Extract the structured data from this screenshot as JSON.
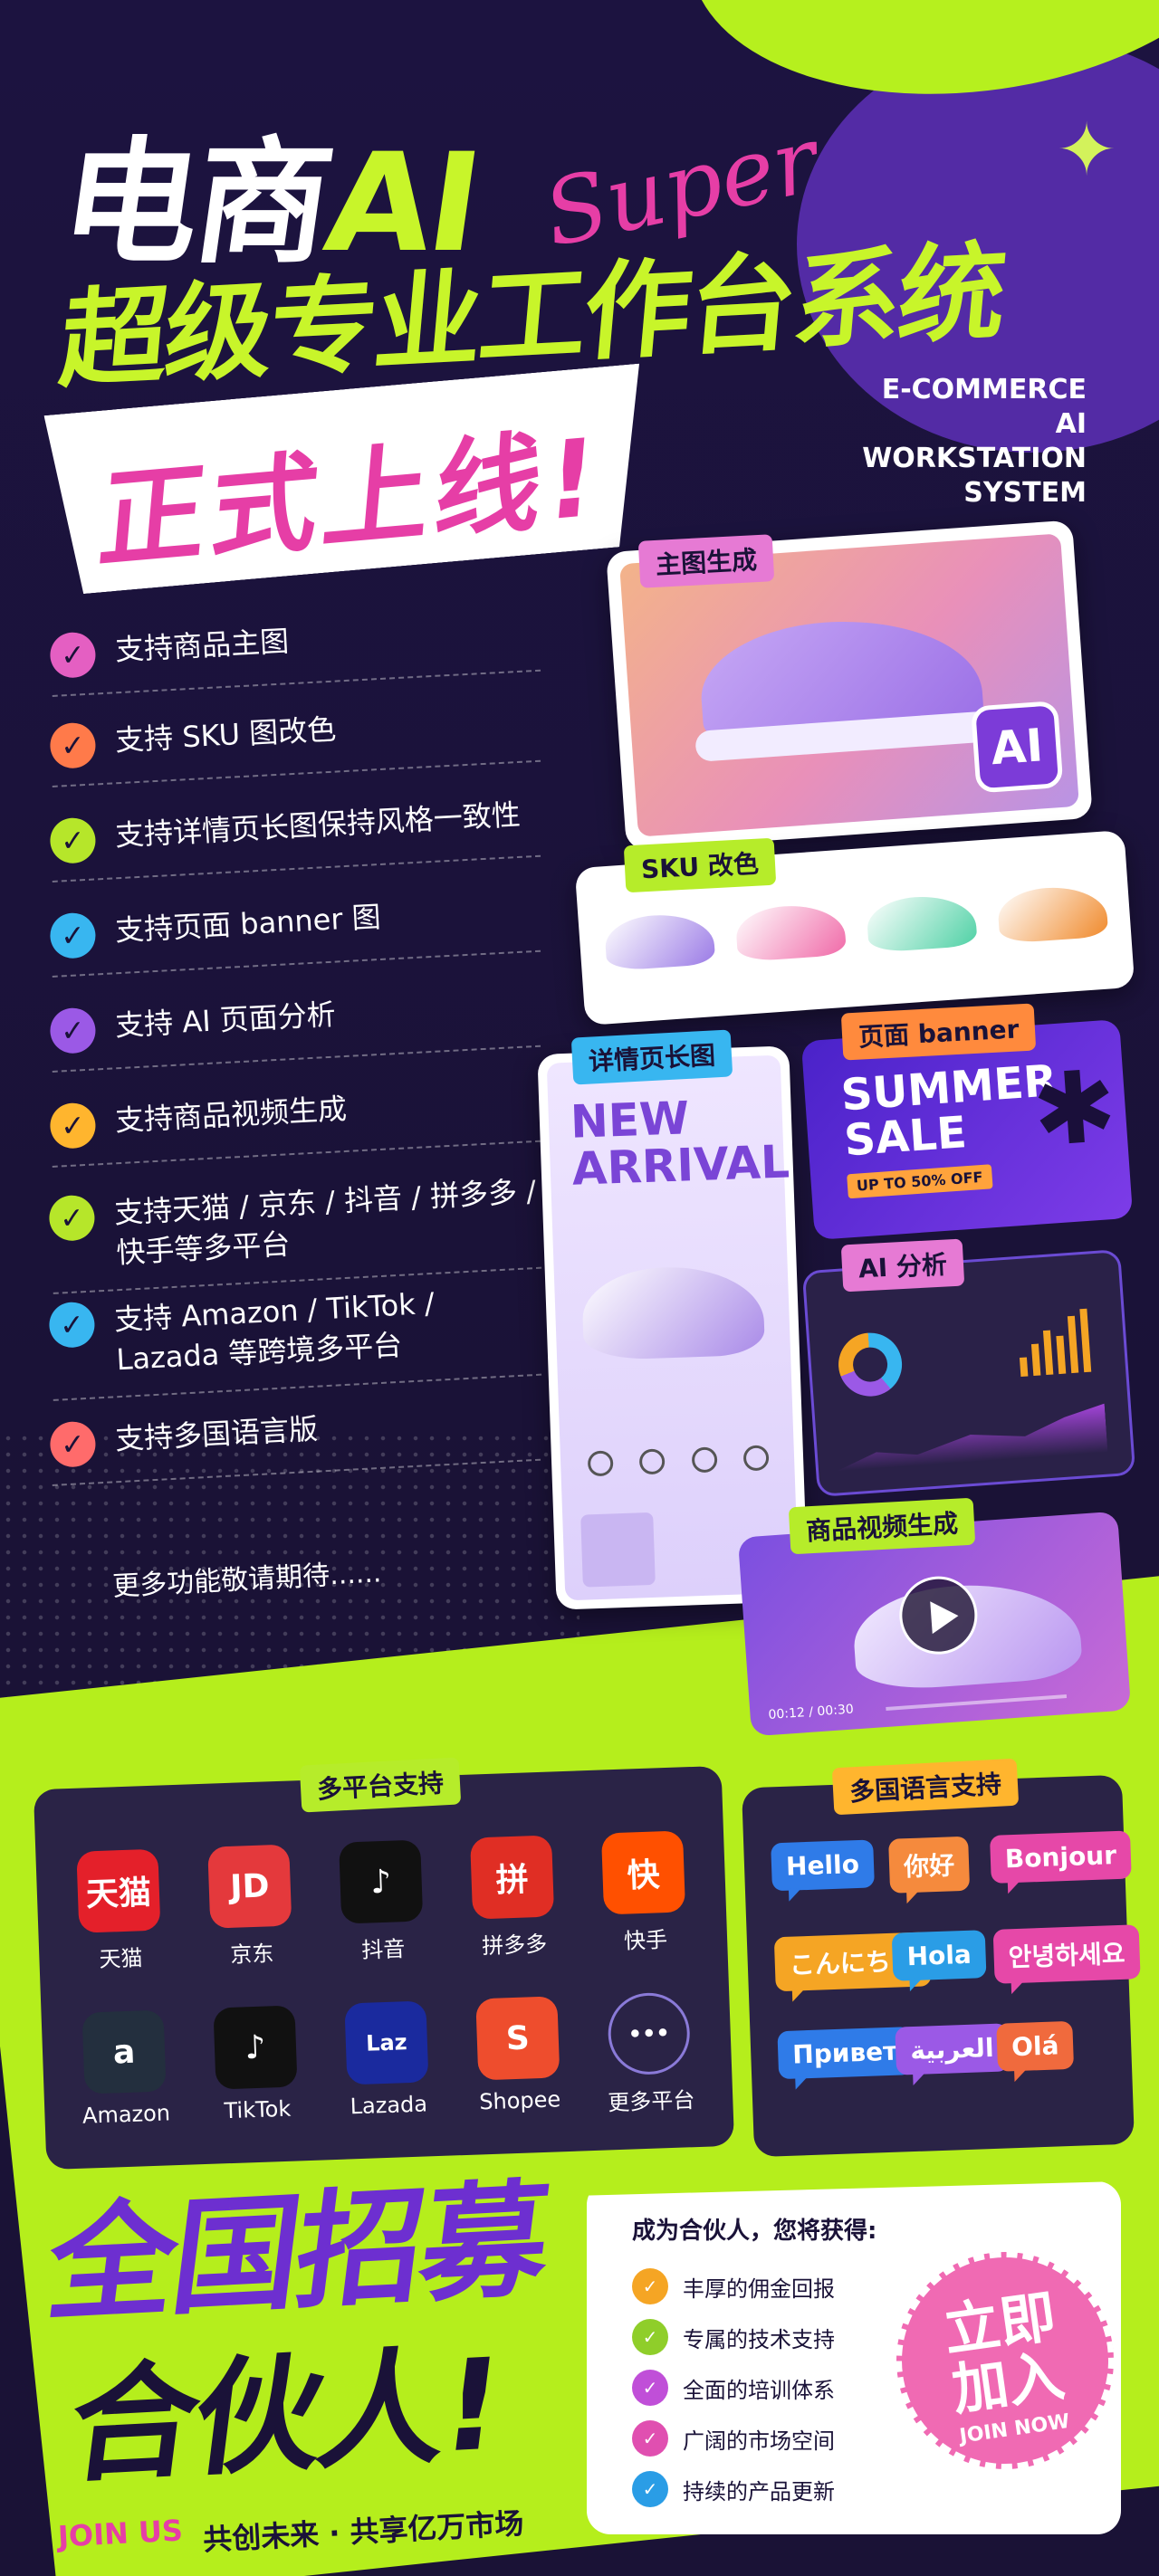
{
  "title": {
    "line1_part1": "电商",
    "line1_part2": "AI",
    "script": "Super",
    "line2": "超级专业工作台系统",
    "english": [
      "E-COMMERCE",
      "AI WORKSTATION",
      "SYSTEM"
    ],
    "launch": "正式上线!"
  },
  "features": [
    {
      "text": "支持商品主图",
      "color": "#e45fc2"
    },
    {
      "text": "支持 SKU 图改色",
      "color": "#ff7a4a"
    },
    {
      "text": "支持详情页长图保持风格一致性",
      "color": "#b6e62a"
    },
    {
      "text": "支持页面 banner 图",
      "color": "#38b6f0"
    },
    {
      "text": "支持 AI 页面分析",
      "color": "#9b59e6"
    },
    {
      "text": "支持商品视频生成",
      "color": "#ffb52e"
    },
    {
      "text": "支持天猫 / 京东 / 抖音 / 拼多多 / 快手等多平台",
      "color": "#b6e62a"
    },
    {
      "text": "支持 Amazon / TikTok / Lazada 等跨境多平台",
      "color": "#38b6f0"
    },
    {
      "text": "支持多国语言版",
      "color": "#ff6b6b"
    }
  ],
  "more_features": "更多功能敬请期待......",
  "cards": {
    "main_image": {
      "tag": "主图生成",
      "badge": "AI"
    },
    "sku": {
      "tag": "SKU 改色",
      "swatches": [
        "#9b7be6",
        "#f06aa8",
        "#4fd1a5",
        "#f08a2c"
      ]
    },
    "detail": {
      "tag": "详情页长图",
      "headline": [
        "NEW",
        "ARRIVAL"
      ]
    },
    "banner": {
      "tag": "页面 banner",
      "headline": [
        "SUMMER",
        "SALE"
      ],
      "badge": "UP TO 50% OFF"
    },
    "analysis": {
      "tag": "AI 分析"
    },
    "video": {
      "tag": "商品视频生成",
      "time": "00:12 / 00:30"
    }
  },
  "platforms": {
    "tag": "多平台支持",
    "items": [
      {
        "name": "天猫",
        "glyph": "天猫",
        "bg": "#e4202a"
      },
      {
        "name": "京东",
        "glyph": "JD",
        "bg": "#e4393c"
      },
      {
        "name": "抖音",
        "glyph": "♪",
        "bg": "#111111"
      },
      {
        "name": "拼多多",
        "glyph": "拼",
        "bg": "#e02e24"
      },
      {
        "name": "快手",
        "glyph": "快",
        "bg": "#ff5000"
      },
      {
        "name": "Amazon",
        "glyph": "a",
        "bg": "#232f3e"
      },
      {
        "name": "TikTok",
        "glyph": "♪",
        "bg": "#111111"
      },
      {
        "name": "Lazada",
        "glyph": "Laz",
        "bg": "#1a2a9e"
      },
      {
        "name": "Shopee",
        "glyph": "S",
        "bg": "#ee4d2d"
      },
      {
        "name": "更多平台",
        "glyph": "•••",
        "bg": "#2a2346"
      }
    ]
  },
  "languages": {
    "tag": "多国语言支持",
    "items": [
      {
        "text": "Hello",
        "color": "#2f7be8"
      },
      {
        "text": "你好",
        "color": "#f58a3d"
      },
      {
        "text": "Bonjour",
        "color": "#e648a8"
      },
      {
        "text": "こんにちは",
        "color": "#f5a524"
      },
      {
        "text": "Hola",
        "color": "#2a9de6"
      },
      {
        "text": "안녕하세요",
        "color": "#e648a8"
      },
      {
        "text": "Привет",
        "color": "#2f7be8"
      },
      {
        "text": "العربية",
        "color": "#9b59e6"
      },
      {
        "text": "Olá",
        "color": "#f06a3d"
      }
    ]
  },
  "recruit": {
    "line1": "全国招募",
    "line2": "合伙人!",
    "join_us": "JOIN US",
    "slogan": "共创未来 · 共享亿万市场",
    "benefits_title": "成为合伙人，您将获得:",
    "benefits": [
      {
        "text": "丰厚的佣金回报",
        "color": "#f5a524"
      },
      {
        "text": "专属的技术支持",
        "color": "#8fce2a"
      },
      {
        "text": "全面的培训体系",
        "color": "#c04fd8"
      },
      {
        "text": "广阔的市场空间",
        "color": "#e04fb0"
      },
      {
        "text": "持续的产品更新",
        "color": "#2a9de6"
      }
    ],
    "button_line1": "立即",
    "button_line2": "加入",
    "button_sub": "JOIN NOW"
  }
}
